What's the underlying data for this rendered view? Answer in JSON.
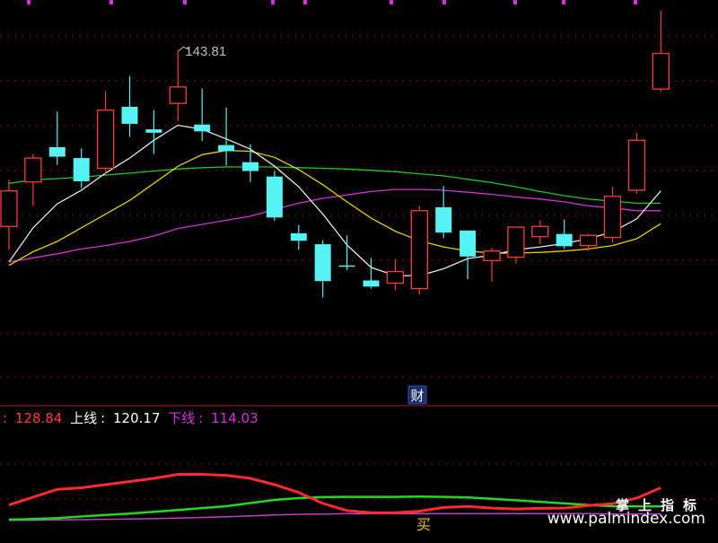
{
  "chart_data": [
    {
      "type": "candlestick",
      "title": "",
      "ylim": [
        108,
        150
      ],
      "high_label": "143.81",
      "event_marker": "财",
      "colors": {
        "up": "#ff3b3b",
        "down": "#55f3f3",
        "ma_white": "#e8e8e8",
        "ma_yellow": "#e6d000",
        "ma_magenta": "#d633d6",
        "ma_green": "#22c922"
      },
      "candles": [
        {
          "o": 118.2,
          "h": 125.0,
          "l": 114.8,
          "c": 123.4
        },
        {
          "o": 124.7,
          "h": 128.8,
          "l": 121.2,
          "c": 128.2
        },
        {
          "o": 129.8,
          "h": 135.0,
          "l": 127.2,
          "c": 128.4
        },
        {
          "o": 128.2,
          "h": 129.6,
          "l": 123.8,
          "c": 124.8
        },
        {
          "o": 126.7,
          "h": 138.0,
          "l": 125.7,
          "c": 135.2
        },
        {
          "o": 135.7,
          "h": 140.2,
          "l": 131.3,
          "c": 133.2
        },
        {
          "o": 132.4,
          "h": 135.2,
          "l": 128.8,
          "c": 131.9
        },
        {
          "o": 136.2,
          "h": 143.8,
          "l": 133.6,
          "c": 138.6
        },
        {
          "o": 133.1,
          "h": 138.4,
          "l": 130.7,
          "c": 132.1
        },
        {
          "o": 130.1,
          "h": 135.6,
          "l": 127.1,
          "c": 129.2
        },
        {
          "o": 127.6,
          "h": 130.2,
          "l": 124.7,
          "c": 126.3
        },
        {
          "o": 125.5,
          "h": 126.3,
          "l": 119.0,
          "c": 119.5
        },
        {
          "o": 117.2,
          "h": 118.4,
          "l": 114.8,
          "c": 116.1
        },
        {
          "o": 115.6,
          "h": 116.2,
          "l": 107.8,
          "c": 110.2
        },
        {
          "o": 112.5,
          "h": 116.9,
          "l": 111.8,
          "c": 112.4
        },
        {
          "o": 110.3,
          "h": 113.6,
          "l": 109.1,
          "c": 109.4
        },
        {
          "o": 109.9,
          "h": 113.4,
          "l": 108.9,
          "c": 111.6
        },
        {
          "o": 109.1,
          "h": 121.2,
          "l": 108.2,
          "c": 120.5
        },
        {
          "o": 121.0,
          "h": 124.1,
          "l": 116.5,
          "c": 117.3
        },
        {
          "o": 117.6,
          "h": 117.4,
          "l": 110.5,
          "c": 113.8
        },
        {
          "o": 113.2,
          "h": 115.1,
          "l": 110.1,
          "c": 114.6
        },
        {
          "o": 113.7,
          "h": 118.1,
          "l": 112.8,
          "c": 118.1
        },
        {
          "o": 116.7,
          "h": 119.1,
          "l": 115.6,
          "c": 118.2
        },
        {
          "o": 117.1,
          "h": 119.2,
          "l": 114.9,
          "c": 115.3
        },
        {
          "o": 115.4,
          "h": 117.1,
          "l": 114.6,
          "c": 116.9
        },
        {
          "o": 116.6,
          "h": 124.0,
          "l": 115.8,
          "c": 122.6
        },
        {
          "o": 123.5,
          "h": 131.9,
          "l": 123.0,
          "c": 130.8
        },
        {
          "o": 138.3,
          "h": 149.8,
          "l": 137.9,
          "c": 143.5
        }
      ],
      "ma_white": [
        113.0,
        118.0,
        121.5,
        123.5,
        126.0,
        128.2,
        130.8,
        133.0,
        132.4,
        131.0,
        129.5,
        127.0,
        124.0,
        120.0,
        115.5,
        112.2,
        111.0,
        111.0,
        112.0,
        113.5,
        114.0,
        114.8,
        115.2,
        115.7,
        116.4,
        117.4,
        119.3,
        123.4
      ],
      "ma_yellow": [
        112.5,
        114.5,
        116.0,
        118.0,
        120.0,
        122.0,
        124.5,
        127.0,
        128.7,
        129.3,
        129.2,
        128.3,
        126.5,
        124.3,
        121.8,
        119.4,
        117.5,
        116.1,
        115.2,
        114.6,
        114.3,
        114.3,
        114.4,
        114.6,
        114.9,
        115.4,
        116.4,
        118.6
      ],
      "ma_green": [
        124.5,
        125.0,
        125.2,
        125.4,
        125.7,
        126.0,
        126.3,
        126.6,
        126.8,
        126.9,
        126.9,
        126.9,
        126.8,
        126.7,
        126.6,
        126.4,
        126.2,
        125.9,
        125.6,
        125.1,
        124.6,
        124.0,
        123.3,
        122.7,
        122.2,
        121.9,
        121.6,
        121.6
      ],
      "ma_magenta": [
        113.0,
        113.6,
        114.2,
        114.9,
        115.4,
        116.0,
        116.8,
        117.9,
        118.5,
        119.1,
        119.7,
        120.7,
        121.6,
        122.3,
        122.8,
        123.3,
        123.6,
        123.6,
        123.5,
        123.2,
        122.9,
        122.5,
        122.2,
        121.8,
        121.2,
        120.9,
        120.5,
        120.5
      ]
    },
    {
      "type": "line",
      "legend": [
        {
          "name": "线",
          "value": "128.84",
          "color": "#ff3b3b"
        },
        {
          "name": "上线",
          "value": "120.17",
          "color": "#ffffff"
        },
        {
          "name": "下线",
          "value": "114.03",
          "color": "#d633d6"
        }
      ],
      "ylim": [
        112,
        135
      ],
      "buy_marker": "买",
      "series": [
        {
          "color": "#ff2a2a",
          "values": [
            117,
            119.5,
            122,
            122.5,
            123.5,
            124.5,
            125.5,
            126.8,
            126.8,
            126.5,
            125.5,
            123.5,
            121,
            117.5,
            115.2,
            114.5,
            114.5,
            115,
            116.2,
            116.5,
            116,
            115.7,
            115.9,
            116,
            116.8,
            117.4,
            119.2,
            122.5
          ]
        },
        {
          "color": "#22d922",
          "values": [
            112.3,
            112.5,
            112.8,
            113.3,
            113.8,
            114.2,
            114.8,
            115.4,
            116.0,
            116.6,
            117.6,
            118.6,
            119.2,
            119.5,
            119.6,
            119.6,
            119.6,
            119.7,
            119.6,
            119.4,
            119.0,
            118.5,
            118.0,
            117.5,
            117.0,
            116.6,
            116.5,
            116.5
          ]
        },
        {
          "color": "#c23ec2",
          "values": [
            112.1,
            112.1,
            112.2,
            112.3,
            112.4,
            112.5,
            112.6,
            112.8,
            113.0,
            113.2,
            113.5,
            113.8,
            114.0,
            114.1,
            114.2,
            114.2,
            114.2,
            114.2,
            114.2,
            114.2,
            114.2,
            114.2,
            114.2,
            114.2,
            114.2,
            114.1,
            114.1,
            114.1
          ]
        }
      ]
    }
  ],
  "watermark": {
    "title": "掌上指标",
    "url": "www.palmindex.com"
  }
}
